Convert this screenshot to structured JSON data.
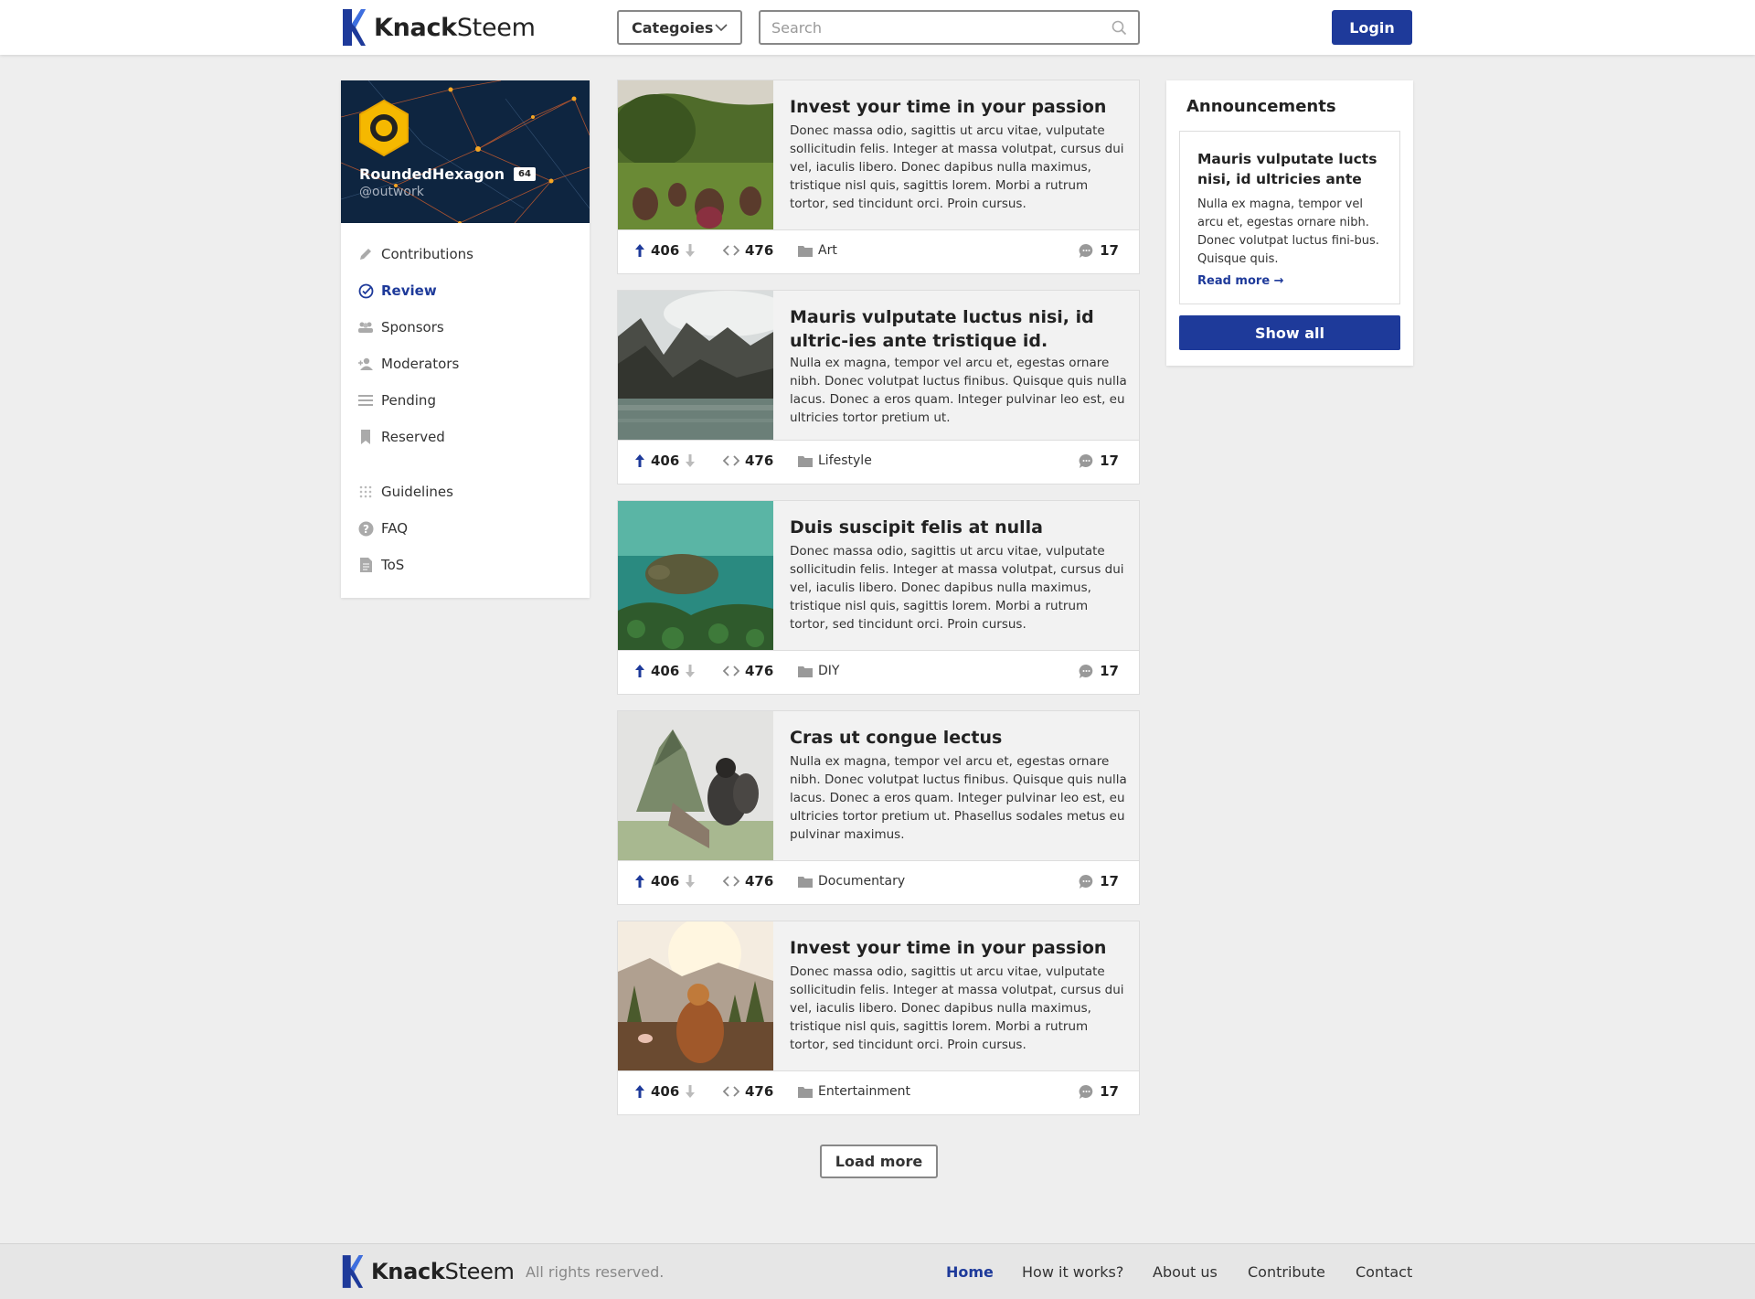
{
  "brand": {
    "name_bold": "Knack",
    "name_light": "Steem"
  },
  "header": {
    "categories_label": "Categoies",
    "search_placeholder": "Search",
    "login_label": "Login"
  },
  "profile": {
    "name": "RoundedHexagon",
    "reputation": "64",
    "handle": "@outwork"
  },
  "sidebar": {
    "items": [
      {
        "label": "Contributions",
        "icon": "pencil-icon",
        "active": false
      },
      {
        "label": "Review",
        "icon": "check-circle-icon",
        "active": true
      },
      {
        "label": "Sponsors",
        "icon": "group-icon",
        "active": false
      },
      {
        "label": "Moderators",
        "icon": "user-add-icon",
        "active": false
      },
      {
        "label": "Pending",
        "icon": "list-icon",
        "active": false
      },
      {
        "label": "Reserved",
        "icon": "bookmark-icon",
        "active": false
      },
      {
        "label": "Guidelines",
        "icon": "grid-dots-icon",
        "active": false
      },
      {
        "label": "FAQ",
        "icon": "question-icon",
        "active": false
      },
      {
        "label": "ToS",
        "icon": "document-icon",
        "active": false
      }
    ]
  },
  "posts": [
    {
      "title": "Invest your time in your passion",
      "body": "Donec massa odio, sagittis ut arcu vitae, vulputate sollicitudin felis. Integer at massa volutpat, cursus dui vel, iaculis libero. Donec dapibus nulla maximus, tristique nisl quis, sagittis lorem. Morbi a rutrum tortor, sed tincidunt orci. Proin cursus.",
      "votes": "406",
      "resteems": "476",
      "category": "Art",
      "comments": "17"
    },
    {
      "title": "Mauris vulputate luctus nisi, id ultric-ies ante tristique id.",
      "body": "Nulla ex magna, tempor vel arcu et, egestas ornare nibh. Donec volutpat luctus finibus. Quisque quis nulla lacus. Donec a eros quam. Integer pulvinar leo est, eu ultricies tortor pretium ut.",
      "votes": "406",
      "resteems": "476",
      "category": "Lifestyle",
      "comments": "17"
    },
    {
      "title": "Duis suscipit felis at nulla",
      "body": "Donec massa odio, sagittis ut arcu vitae, vulputate sollicitudin felis. Integer at massa volutpat, cursus dui vel, iaculis libero. Donec dapibus nulla maximus, tristique nisl quis, sagittis lorem. Morbi a rutrum tortor, sed tincidunt orci. Proin cursus.",
      "votes": "406",
      "resteems": "476",
      "category": "DIY",
      "comments": "17"
    },
    {
      "title": "Cras ut congue lectus",
      "body": "Nulla ex magna, tempor vel arcu et, egestas ornare nibh. Donec volutpat luctus finibus. Quisque quis nulla lacus. Donec a eros quam. Integer pulvinar leo est, eu ultricies tortor pretium ut. Phasellus sodales metus eu pulvinar maximus.",
      "votes": "406",
      "resteems": "476",
      "category": "Documentary",
      "comments": "17"
    },
    {
      "title": "Invest your time in your passion",
      "body": "Donec massa odio, sagittis ut arcu vitae, vulputate sollicitudin felis. Integer at massa volutpat, cursus dui vel, iaculis libero. Donec dapibus nulla maximus, tristique nisl quis, sagittis lorem. Morbi a rutrum tortor, sed tincidunt orci. Proin cursus.",
      "votes": "406",
      "resteems": "476",
      "category": "Entertainment",
      "comments": "17"
    }
  ],
  "load_more_label": "Load more",
  "announcements": {
    "title": "Announcements",
    "item_title": "Mauris vulputate lucts nisi, id ultricies ante",
    "item_body": "Nulla ex magna, tempor vel arcu et, egestas ornare nibh. Donec volutpat luctus fini-bus. Quisque quis.",
    "read_more": "Read more →",
    "show_all": "Show all"
  },
  "footer": {
    "rights": "All rights reserved.",
    "links": [
      "Home",
      "How it works?",
      "About us",
      "Contribute",
      "Contact"
    ]
  },
  "colors": {
    "accent": "#1e3a9a",
    "background": "#eeeeee",
    "hero": "#0e2540",
    "avatar": "#f5b800"
  }
}
